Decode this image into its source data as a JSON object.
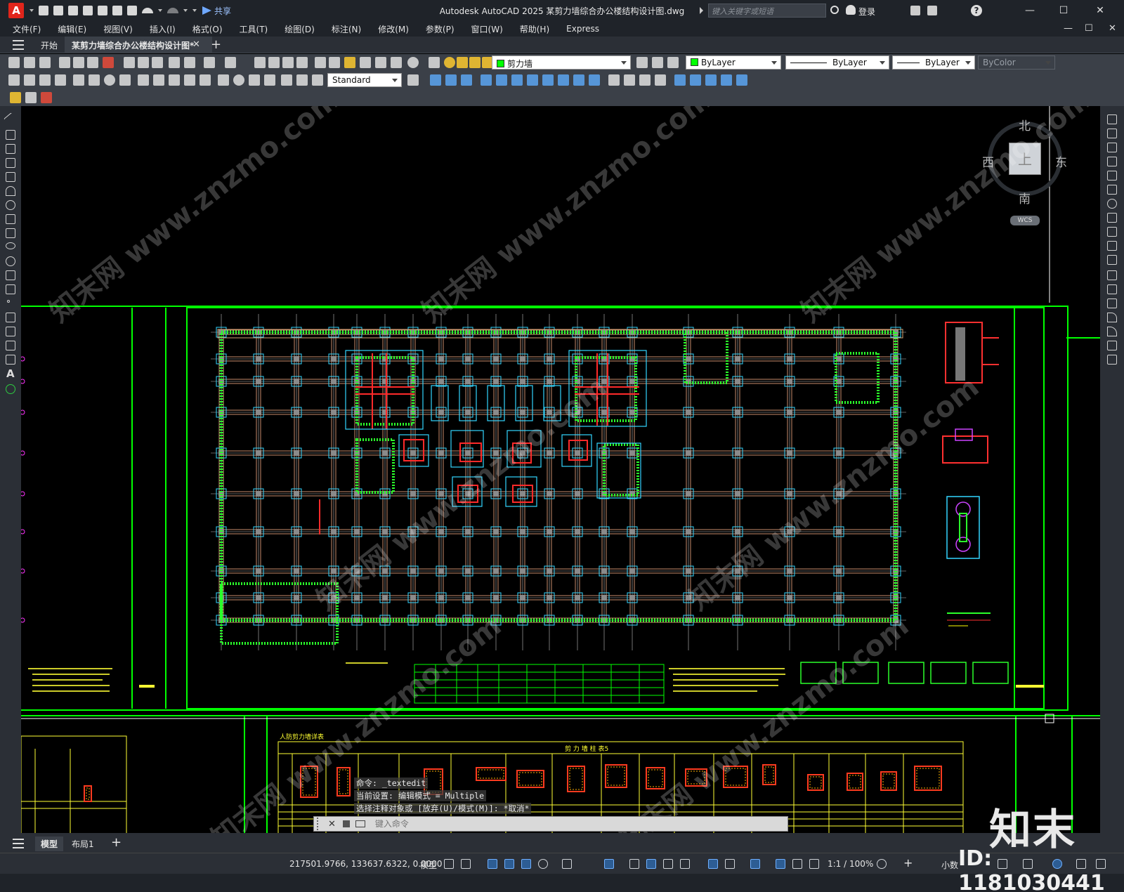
{
  "app": {
    "logo_letter": "A",
    "title": "Autodesk AutoCAD 2025    某剪力墙综合办公楼结构设计图.dwg",
    "share_label": "共享",
    "search_placeholder": "键入关键字或短语",
    "login_label": "登录",
    "help_label": "?"
  },
  "window_controls": {
    "minimize": "—",
    "maximize": "☐",
    "close": "✕"
  },
  "menu": [
    "文件(F)",
    "编辑(E)",
    "视图(V)",
    "插入(I)",
    "格式(O)",
    "工具(T)",
    "绘图(D)",
    "标注(N)",
    "修改(M)",
    "参数(P)",
    "窗口(W)",
    "帮助(H)",
    "Express"
  ],
  "file_tabs": {
    "start": "开始",
    "active": "某剪力墙综合办公楼结构设计图*",
    "close": "✕",
    "add": "+"
  },
  "properties": {
    "layer": "剪力墙",
    "layer_color": "#00ff00",
    "color": "ByLayer",
    "linetype": "ByLayer",
    "lineweight": "ByLayer",
    "plotstyle": "ByColor",
    "dimstyle": "Standard"
  },
  "viewcube": {
    "north": "北",
    "south": "南",
    "west": "西",
    "east": "东",
    "top": "上",
    "wcs": "WCS"
  },
  "drawing": {
    "section_title": "人防剪力墙详表",
    "table_title": "剪 力 墙 柱 表5"
  },
  "command": {
    "history": [
      "命令:  _textedit",
      "当前设置: 编辑模式 = Multiple",
      "选择注释对象或 [放弃(U)/模式(M)]: *取消*"
    ],
    "input_placeholder": "键入命令"
  },
  "layouts": {
    "model": "模型",
    "layout1": "布局1",
    "add": "+"
  },
  "status": {
    "coordinates": "217501.9766, 133637.6322, 0.0000",
    "space": "模型",
    "scale": "1:1 / 100%",
    "units": "小数"
  },
  "watermark": {
    "brand": "知末",
    "id": "ID: 1181030441",
    "site": "知末网 www.znzmo.com"
  }
}
